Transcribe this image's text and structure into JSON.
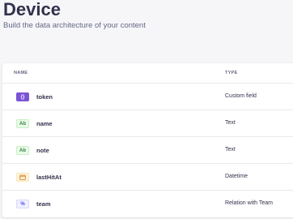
{
  "header": {
    "title": "Device",
    "subtitle": "Build the data architecture of your content"
  },
  "table": {
    "columns": {
      "name": "NAME",
      "type": "TYPE"
    },
    "rows": [
      {
        "icon": "custom-field-icon",
        "icon_text": "{}",
        "name": "token",
        "type": "Custom field"
      },
      {
        "icon": "text-icon",
        "icon_text": "Ab",
        "name": "name",
        "type": "Text"
      },
      {
        "icon": "text-icon",
        "icon_text": "Ab",
        "name": "note",
        "type": "Text"
      },
      {
        "icon": "calendar-icon",
        "icon_text": "▢",
        "name": "lastHitAt",
        "type": "Datetime"
      },
      {
        "icon": "relation-icon",
        "icon_text": "%",
        "name": "team",
        "type": "Relation with Team"
      }
    ]
  },
  "colors": {
    "background": "#f6f6f9",
    "custom_field": "#7b53d6",
    "text_badge": "#328048",
    "date_badge": "#d9822f",
    "relation_badge": "#4945ff"
  }
}
